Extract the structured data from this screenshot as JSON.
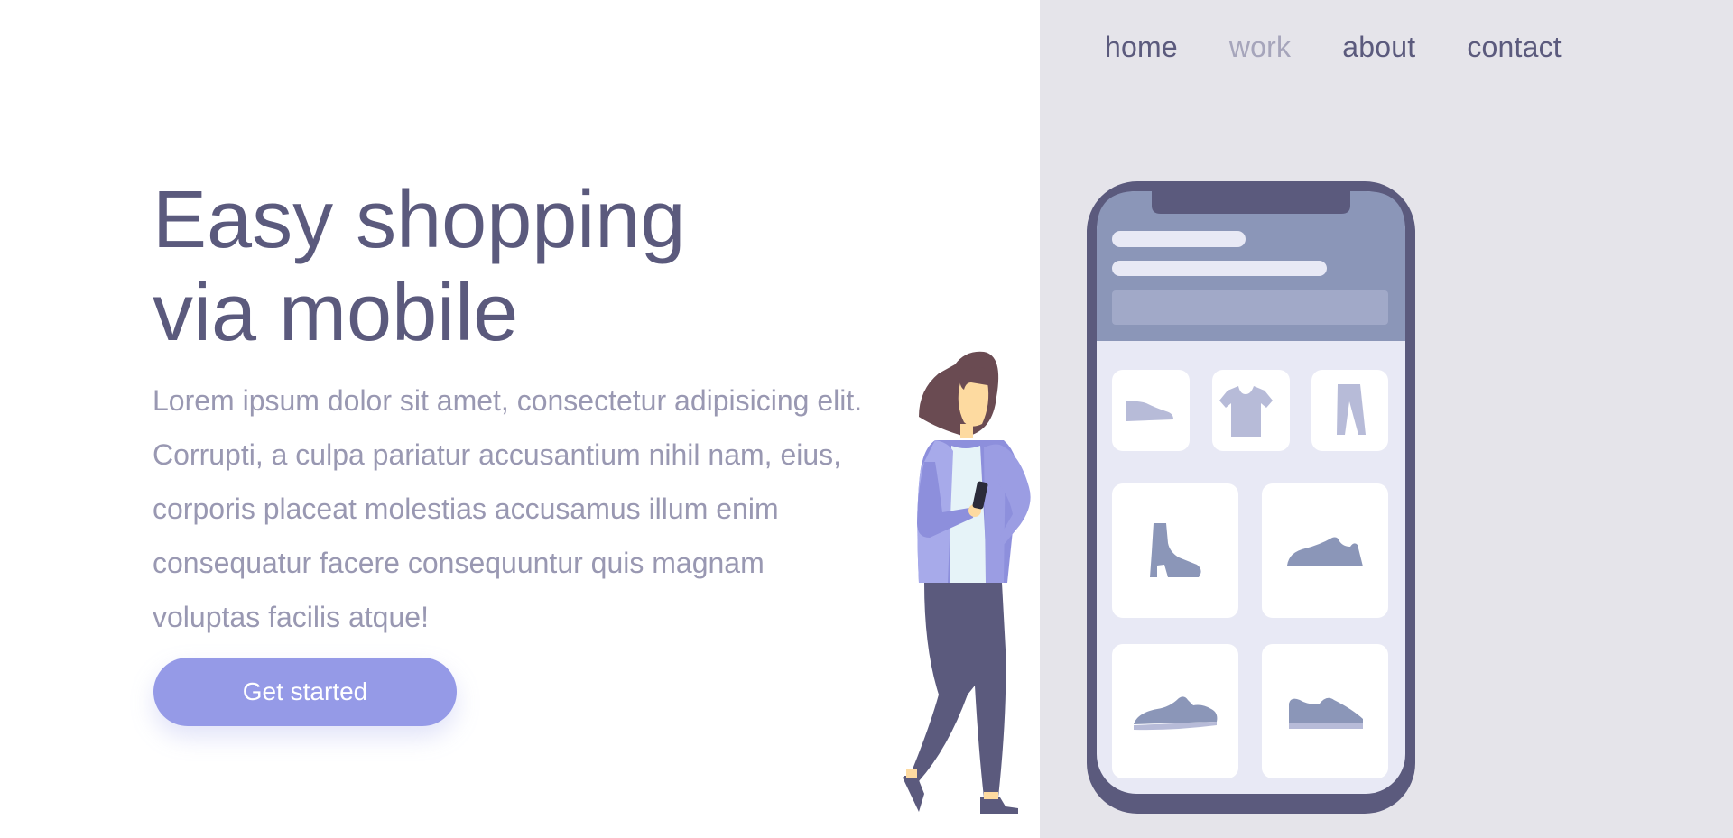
{
  "nav": {
    "items": [
      {
        "label": "home",
        "active": false
      },
      {
        "label": "work",
        "active": true
      },
      {
        "label": "about",
        "active": false
      },
      {
        "label": "contact",
        "active": false
      }
    ]
  },
  "hero": {
    "title_line1": "Easy shopping",
    "title_line2": "via mobile",
    "body_lines": [
      "Lorem ipsum dolor sit amet, consectetur adipisicing elit.",
      "Corrupti, a culpa pariatur accusantium nihil nam, eius,",
      "corporis placeat molestias accusamus illum enim",
      "consequatur facere consequuntur quis magnam",
      "voluptas facilis atque!"
    ],
    "cta_label": "Get started"
  },
  "colors": {
    "primary_text": "#5b5a7d",
    "muted_text": "#9998b2",
    "accent": "#959ae7",
    "panel_bg": "#e5e4ea",
    "phone_frame": "#5b5a7d"
  },
  "illustration": {
    "phone_products": [
      "flat-shoe-icon",
      "tshirt-icon",
      "pants-icon",
      "boot-icon",
      "sneaker-icon",
      "sneaker-icon",
      "sneaker-icon"
    ],
    "figure": "woman-with-phone"
  }
}
